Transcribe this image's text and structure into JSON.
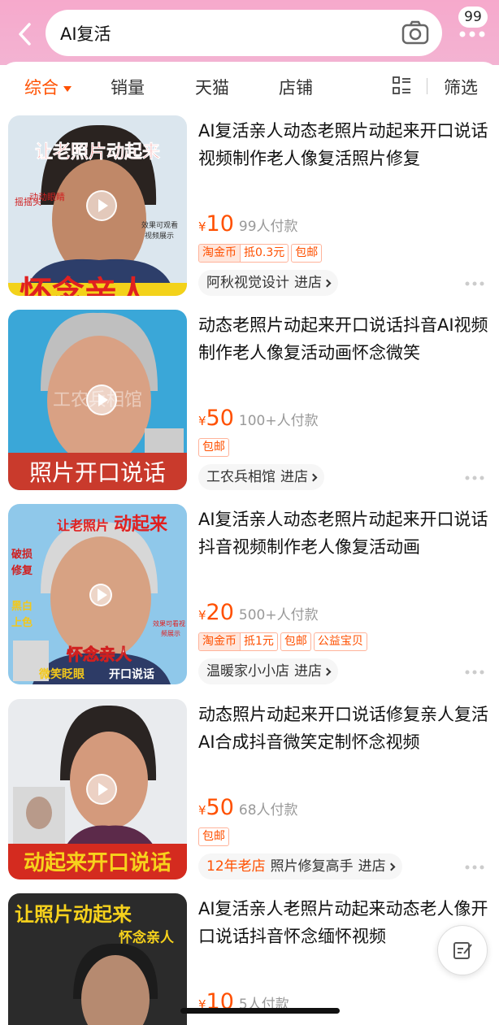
{
  "search": {
    "query": "AI复活"
  },
  "header": {
    "message_count": "99"
  },
  "tabs": [
    {
      "label": "综合",
      "active": true
    },
    {
      "label": "销量"
    },
    {
      "label": "天猫"
    },
    {
      "label": "店铺"
    }
  ],
  "filter_label": "筛选",
  "theme": {
    "accent": "#ff5000",
    "header_pink": "#f6a9cc"
  },
  "products": [
    {
      "title": "AI复活亲人动态老照片动起来开口说话视频制作老人像复活照片修复",
      "price": "10",
      "sold": "99人付款",
      "tags": [
        {
          "a": "淘金币",
          "b": "抵0.3元"
        },
        {
          "a": "包邮"
        }
      ],
      "shop_badge": "",
      "shop": "阿秋视觉设计",
      "enter": "进店",
      "thumb": {
        "top_text": "让老照片动起来",
        "side_text_a": "摇摇头",
        "side_text_b": "动动眼睛",
        "note_a": "效果可观看",
        "note_b": "视频展示",
        "bottom_text": "怀念亲人"
      }
    },
    {
      "title": "动态老照片动起来开口说话抖音AI视频制作老人像复活动画怀念微笑",
      "price": "50",
      "sold": "100+人付款",
      "tags": [
        {
          "a": "包邮"
        }
      ],
      "shop_badge": "",
      "shop": "工农兵相馆",
      "enter": "进店",
      "thumb": {
        "watermark": "工农兵相馆",
        "bottom_text": "照片开口说话"
      }
    },
    {
      "title": "AI复活亲人动态老照片动起来开口说话抖音视频制作老人像复活动画",
      "price": "20",
      "sold": "500+人付款",
      "tags": [
        {
          "a": "淘金币",
          "b": "抵1元"
        },
        {
          "a": "包邮"
        },
        {
          "a": "公益宝贝"
        }
      ],
      "shop_badge": "",
      "shop": "温暖家小小店",
      "enter": "进店",
      "thumb": {
        "top_text_a": "让老照片",
        "top_text_b": "动起来",
        "side_text_a": "破损",
        "side_text_b": "修复",
        "side_text_c": "黑白",
        "side_text_d": "上色",
        "note_a": "效果可看视",
        "note_b": "频展示",
        "mid_text": "怀念亲人",
        "bottom_a": "微笑眨眼",
        "bottom_b": "开口说话"
      }
    },
    {
      "title": "动态照片动起来开口说话修复亲人复活AI合成抖音微笑定制怀念视频",
      "price": "50",
      "sold": "68人付款",
      "tags": [
        {
          "a": "包邮"
        }
      ],
      "shop_badge": "12年老店",
      "shop": "照片修复高手",
      "enter": "进店",
      "thumb": {
        "bottom_text": "动起来开口说话"
      }
    },
    {
      "title": "AI复活亲人老照片动起来动态老人像开口说话抖音怀念缅怀视频",
      "price": "10",
      "sold": "5人付款",
      "tags": [],
      "shop_badge": "",
      "shop": "",
      "enter": "",
      "thumb": {
        "top_text": "让照片动起来",
        "sub_text": "怀念亲人"
      }
    }
  ]
}
